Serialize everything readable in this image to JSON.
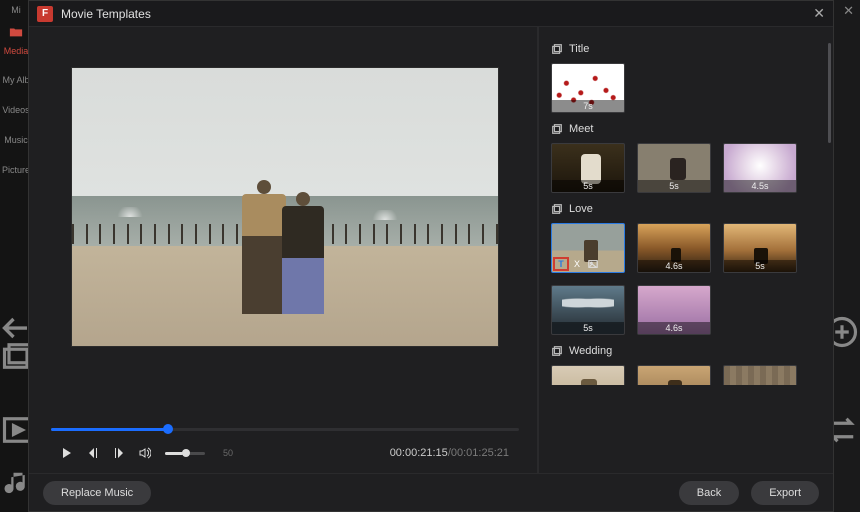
{
  "app": {
    "icon_text": "F",
    "modal_title": "Movie Templates"
  },
  "left_rail": {
    "items": [
      {
        "label": "Mi"
      },
      {
        "label": "Media"
      },
      {
        "label": "My Alb"
      },
      {
        "label": "Videos"
      },
      {
        "label": "Music"
      },
      {
        "label": "Picture"
      }
    ]
  },
  "player": {
    "frame_label": "50",
    "current_time": "00:00:21:15",
    "total_time": "00:01:25:21",
    "progress_percent": 25,
    "volume_percent": 45
  },
  "sections": {
    "title": {
      "label": "Title",
      "thumbs": [
        {
          "duration": "7s"
        }
      ]
    },
    "meet": {
      "label": "Meet",
      "thumbs": [
        {
          "duration": "5s"
        },
        {
          "duration": "5s"
        },
        {
          "duration": "4.5s"
        }
      ]
    },
    "love": {
      "label": "Love",
      "thumbs": [
        {
          "duration": "",
          "selected": true,
          "text_tool": "T",
          "fx_tool": "X"
        },
        {
          "duration": "4.6s"
        },
        {
          "duration": "5s"
        },
        {
          "duration": "5s"
        },
        {
          "duration": "4.6s"
        }
      ]
    },
    "wedding": {
      "label": "Wedding",
      "thumbs": [
        {
          "duration": ""
        },
        {
          "duration": ""
        },
        {
          "duration": ""
        }
      ]
    }
  },
  "buttons": {
    "replace_music": "Replace Music",
    "back": "Back",
    "export": "Export"
  }
}
